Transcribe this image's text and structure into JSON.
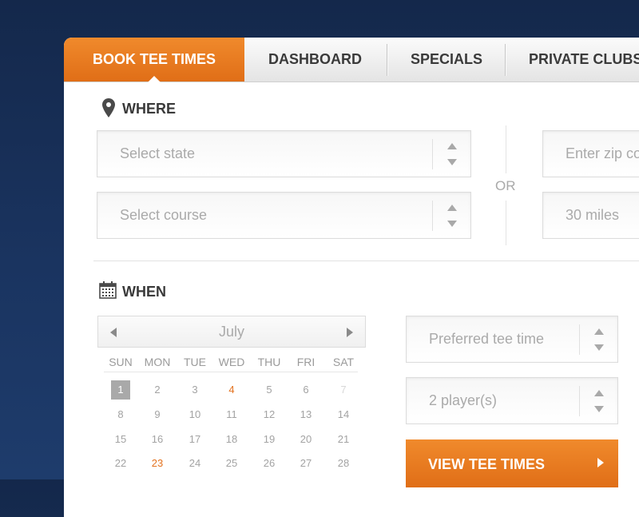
{
  "tabs": [
    {
      "label": "BOOK TEE TIMES",
      "active": true
    },
    {
      "label": "DASHBOARD",
      "active": false
    },
    {
      "label": "SPECIALS",
      "active": false
    },
    {
      "label": "PRIVATE CLUBS",
      "active": false
    }
  ],
  "where": {
    "heading": "WHERE",
    "icon": "map-pin-icon",
    "state_placeholder": "Select state",
    "course_placeholder": "Select course",
    "or_label": "OR",
    "zip_placeholder": "Enter zip co",
    "radius_value": "30 miles"
  },
  "when": {
    "heading": "WHEN",
    "icon": "calendar-icon",
    "month": "July",
    "weekdays": [
      "SUN",
      "MON",
      "TUE",
      "WED",
      "THU",
      "FRI",
      "SAT"
    ],
    "days": [
      [
        "1",
        "2",
        "3",
        "4",
        "5",
        "6",
        "7"
      ],
      [
        "8",
        "9",
        "10",
        "11",
        "12",
        "13",
        "14"
      ],
      [
        "15",
        "16",
        "17",
        "18",
        "19",
        "20",
        "21"
      ],
      [
        "22",
        "23",
        "24",
        "25",
        "26",
        "27",
        "28"
      ]
    ],
    "selected_day": "1",
    "highlighted_days": [
      "4",
      "23"
    ],
    "faded_days": [
      "7"
    ],
    "tee_time_placeholder": "Preferred tee time",
    "players_value": "2 player(s)",
    "cta_label": "VIEW TEE TIMES"
  },
  "colors": {
    "accent": "#e8791f",
    "background": "#1a3460"
  }
}
